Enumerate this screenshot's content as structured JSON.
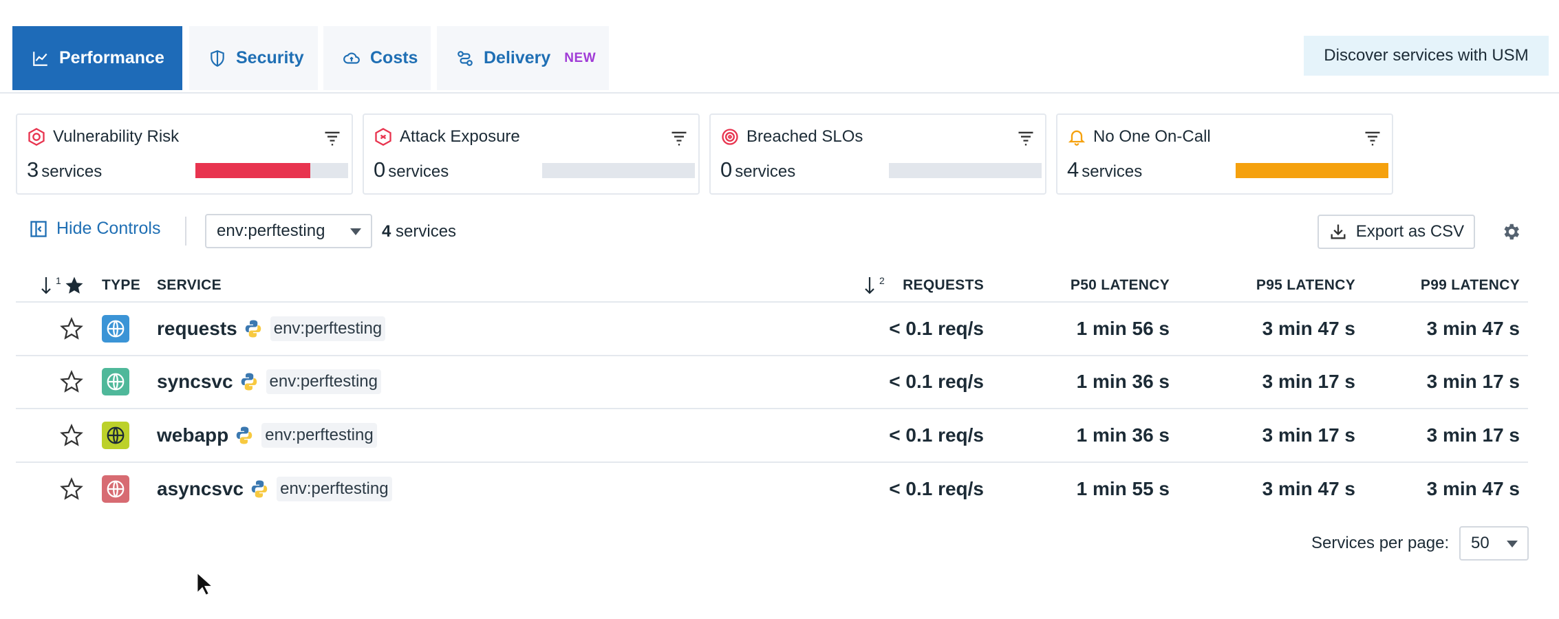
{
  "tabs": [
    {
      "label": "Performance",
      "icon": "line-chart-icon",
      "active": true
    },
    {
      "label": "Security",
      "icon": "shield-icon",
      "active": false
    },
    {
      "label": "Costs",
      "icon": "cloud-dollar-icon",
      "active": false
    },
    {
      "label": "Delivery",
      "icon": "pipeline-icon",
      "active": false,
      "badge": "NEW"
    }
  ],
  "discover_button": "Discover services with USM",
  "cards": [
    {
      "title": "Vulnerability Risk",
      "count": "3",
      "unit": "services",
      "fill_fraction": 0.75,
      "color": "#e8344f",
      "icon": "target-shield-icon"
    },
    {
      "title": "Attack Exposure",
      "count": "0",
      "unit": "services",
      "fill_fraction": 0,
      "color": "#e8344f",
      "icon": "hexagon-bug-icon"
    },
    {
      "title": "Breached SLOs",
      "count": "0",
      "unit": "services",
      "fill_fraction": 0,
      "color": "#e8344f",
      "icon": "target-icon"
    },
    {
      "title": "No One On-Call",
      "count": "4",
      "unit": "services",
      "fill_fraction": 1,
      "color": "#f5a10e",
      "icon": "bell-icon"
    }
  ],
  "controls": {
    "hide_controls": "Hide Controls",
    "env_filter": "env:perftesting",
    "service_count_number": "4",
    "service_count_unit": "services",
    "export_label": "Export as CSV"
  },
  "table": {
    "headers": {
      "sort1": "1",
      "type": "TYPE",
      "service": "SERVICE",
      "sort2": "2",
      "requests": "REQUESTS",
      "p50": "P50 LATENCY",
      "p95": "P95 LATENCY",
      "p99": "P99 LATENCY"
    },
    "rows": [
      {
        "name": "requests",
        "env": "env:perftesting",
        "requests": "< 0.1 req/s",
        "p50": "1 min 56 s",
        "p95": "3 min 47 s",
        "p99": "3 min 47 s",
        "type_color": "#3b94d6"
      },
      {
        "name": "syncsvc",
        "env": "env:perftesting",
        "requests": "< 0.1 req/s",
        "p50": "1 min 36 s",
        "p95": "3 min 17 s",
        "p99": "3 min 17 s",
        "type_color": "#4fb89a"
      },
      {
        "name": "webapp",
        "env": "env:perftesting",
        "requests": "< 0.1 req/s",
        "p50": "1 min 36 s",
        "p95": "3 min 17 s",
        "p99": "3 min 17 s",
        "type_color": "#bcd12a"
      },
      {
        "name": "asyncsvc",
        "env": "env:perftesting",
        "requests": "< 0.1 req/s",
        "p50": "1 min 55 s",
        "p95": "3 min 47 s",
        "p99": "3 min 47 s",
        "type_color": "#d76b72"
      }
    ]
  },
  "pagination": {
    "label": "Services per page:",
    "value": "50"
  }
}
